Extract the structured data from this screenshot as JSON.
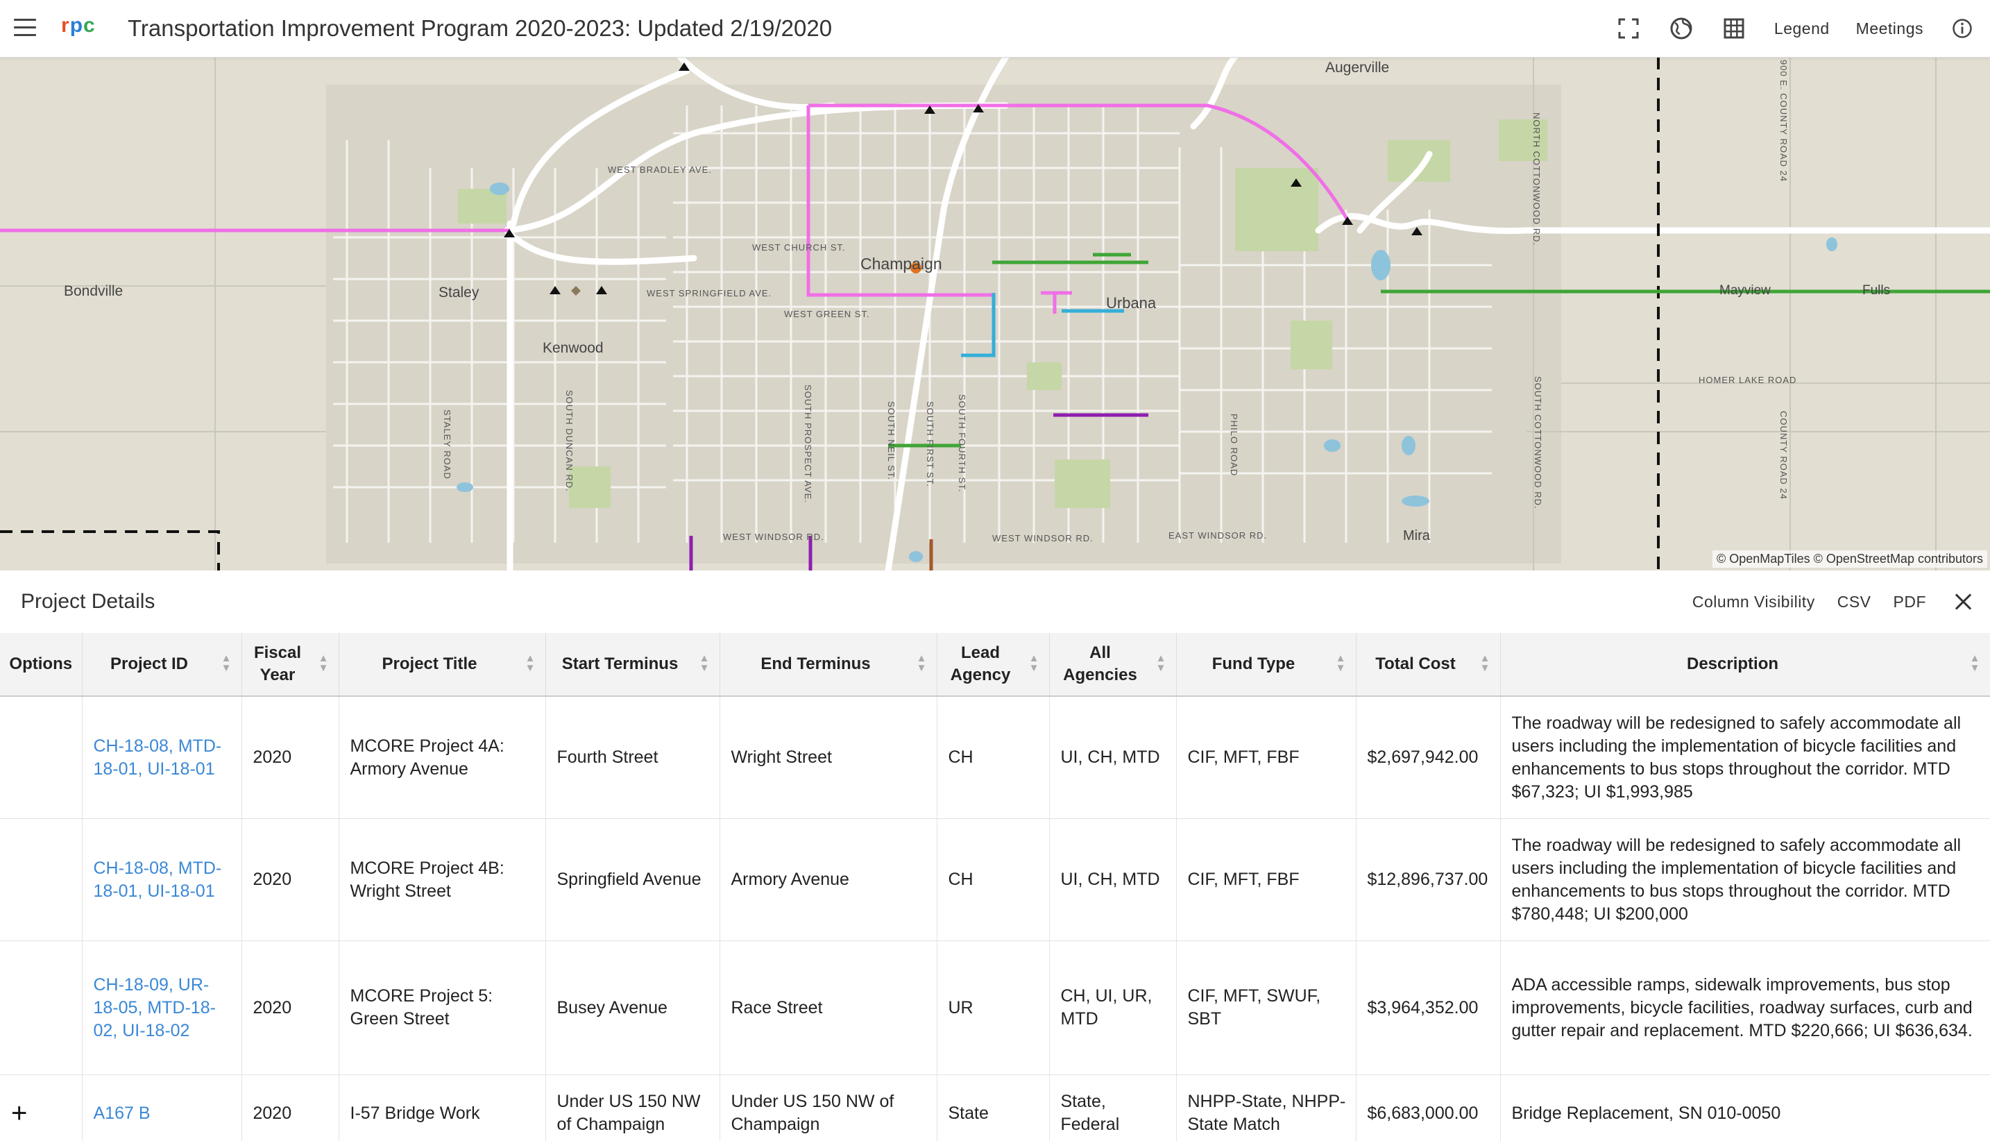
{
  "header": {
    "logo": {
      "r": "r",
      "p": "p",
      "c": "c"
    },
    "title": "Transportation Improvement Program 2020-2023: Updated 2/19/2020",
    "legend_label": "Legend",
    "meetings_label": "Meetings"
  },
  "map": {
    "places": [
      "Augerville",
      "Bondville",
      "Staley",
      "Kenwood",
      "Champaign",
      "Urbana",
      "Mayview",
      "Fulls",
      "Mira"
    ],
    "streets": [
      "WEST BRADLEY AVE.",
      "WEST CHURCH ST.",
      "WEST SPRINGFIELD AVE.",
      "WEST GREEN ST.",
      "HOMER LAKE ROAD",
      "WEST WINDSOR RD.",
      "WEST WINDSOR RD.",
      "EAST WINDSOR RD.",
      "STALEY ROAD",
      "SOUTH DUNCAN RD.",
      "SOUTH PROSPECT AVE.",
      "SOUTH NEIL ST.",
      "SOUTH FIRST ST.",
      "SOUTH FOURTH ST.",
      "PHILO ROAD",
      "NORTH COTTONWOOD RD.",
      "SOUTH COTTONWOOD RD.",
      "900 E. COUNTY ROAD 24",
      "COUNTY ROAD 24"
    ],
    "attribution": "© OpenMapTiles © OpenStreetMap contributors"
  },
  "details": {
    "title": "Project Details",
    "column_visibility": "Column Visibility",
    "csv": "CSV",
    "pdf": "PDF"
  },
  "table": {
    "columns": [
      "Options",
      "Project ID",
      "Fiscal Year",
      "Project Title",
      "Start Terminus",
      "End Terminus",
      "Lead Agency",
      "All Agencies",
      "Fund Type",
      "Total Cost",
      "Description"
    ],
    "rows": [
      {
        "option": "",
        "project_id": "CH-18-08, MTD-18-01, UI-18-01",
        "fiscal_year": "2020",
        "title": "MCORE Project 4A: Armory Avenue",
        "start": "Fourth Street",
        "end": "Wright Street",
        "lead": "CH",
        "all": "UI, CH, MTD",
        "fund": "CIF, MFT, FBF",
        "cost": "$2,697,942.00",
        "description": "The roadway will be redesigned to safely accommodate all users including the implementation of bicycle facilities and enhancements to bus stops throughout the corridor. MTD $67,323; UI $1,993,985"
      },
      {
        "option": "",
        "project_id": "CH-18-08, MTD-18-01, UI-18-01",
        "fiscal_year": "2020",
        "title": "MCORE Project 4B: Wright Street",
        "start": "Springfield Avenue",
        "end": "Armory Avenue",
        "lead": "CH",
        "all": "UI, CH, MTD",
        "fund": "CIF, MFT, FBF",
        "cost": "$12,896,737.00",
        "description": "The roadway will be redesigned to safely accommodate all users including the implementation of bicycle facilities and enhancements to bus stops throughout the corridor. MTD $780,448; UI $200,000"
      },
      {
        "option": "",
        "project_id": "CH-18-09, UR-18-05, MTD-18-02, UI-18-02",
        "fiscal_year": "2020",
        "title": "MCORE Project 5: Green Street",
        "start": "Busey Avenue",
        "end": "Race Street",
        "lead": "UR",
        "all": "CH, UI, UR, MTD",
        "fund": "CIF, MFT, SWUF, SBT",
        "cost": "$3,964,352.00",
        "description": "ADA accessible ramps, sidewalk improvements, bus stop improvements, bicycle facilities, roadway surfaces, curb and gutter repair and replacement. MTD $220,666; UI $636,634."
      },
      {
        "option": "+",
        "project_id": "A167 B",
        "fiscal_year": "2020",
        "title": "I-57 Bridge Work",
        "start": "Under US 150 NW of Champaign",
        "end": "Under US 150 NW of Champaign",
        "lead": "State",
        "all": "State, Federal",
        "fund": "NHPP-State, NHPP-State Match",
        "cost": "$6,683,000.00",
        "description": "Bridge Replacement, SN 010-0050"
      }
    ]
  },
  "colors": {
    "map_bg": "#e2ded2",
    "link": "#3b88d6",
    "pink_route": "#f06fe6",
    "green_route": "#3fa535",
    "cyan_route": "#34aed8",
    "purple_route": "#8e1fb0",
    "water": "#8ec3dc",
    "park": "#c5d7a6"
  }
}
